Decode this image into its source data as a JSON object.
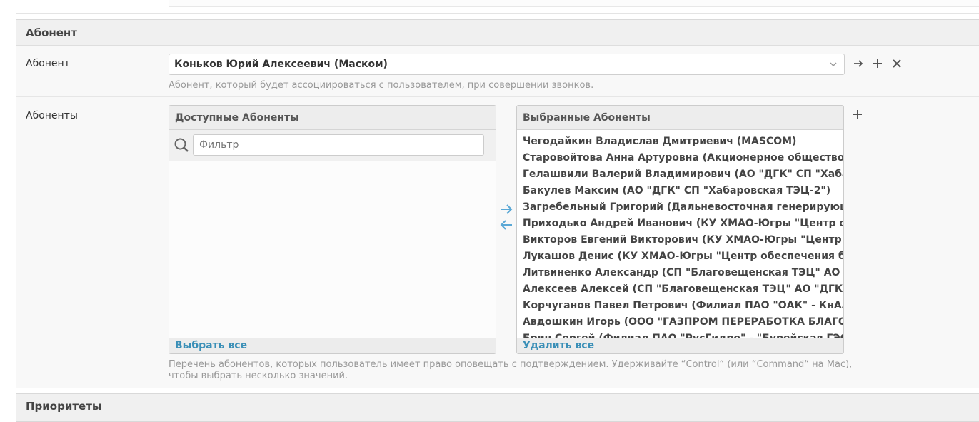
{
  "section": {
    "title": "Абонент",
    "subscriber_field": {
      "label": "Абонент",
      "value": "Коньков Юрий Алексеевич (Маском)",
      "help": "Абонент, который будет ассоциироваться с пользователем, при совершении звонков."
    },
    "subscribers_field": {
      "label": "Абоненты",
      "available": {
        "title": "Доступные Абоненты",
        "filter_placeholder": "Фильтр",
        "choose_all": "Выбрать все"
      },
      "chosen": {
        "title": "Выбранные Абоненты",
        "remove_all": "Удалить все",
        "items": [
          "Чегодайкин Владислав Дмитриевич (MASCOM)",
          "Старовойтова Анна Артуровна (Акционерное общество \"Кор",
          "Гелашвили Валерий Владимирович (АО \"ДГК\" СП \"Хабаров",
          "Бакулев Максим (АО \"ДГК\" СП \"Хабаровская ТЭЦ-2\")",
          "Загребельный Григорий (Дальневосточная генерирующая ко",
          "Приходько Андрей Иванович (КУ ХМАО-Югры \"Центр обеспе",
          "Викторов Евгений Викторович (КУ ХМАО-Югры \"Центр обесп",
          "Лукашов Денис (КУ ХМАО-Югры \"Центр обеспечения безопа",
          "Литвиненко Александр (СП \"Благовещенская ТЭЦ\" АО \"ДГК",
          "Алексеев Алексей (СП \"Благовещенская ТЭЦ\" АО \"ДГК\")",
          "Корчуганов Павел Петрович (Филиал ПАО \"ОАК\" - КнААЗ им",
          "Авдошкин Игорь (ООО \"ГАЗПРОМ ПЕРЕРАБОТКА БЛАГОВЕ",
          "Брин Сергей (Филиал ПАО \"РусГидро\" - \"Бурейская ГЭС\")"
        ]
      },
      "help": "Перечень абонентов, которых пользователь имеет право оповещать с подтверждением. Удерживайте “Control“ (или “Command“ на Mac), чтобы выбрать несколько значений."
    }
  },
  "next_section": {
    "title": "Приоритеты"
  },
  "icons": {
    "dropdown": "chevron-down-icon",
    "edit": "arrow-right-icon",
    "add": "plus-icon",
    "delete": "close-icon",
    "search": "magnifier-icon",
    "move_right": "arrow-right-icon",
    "move_left": "arrow-left-icon"
  },
  "colors": {
    "accent": "#3a8fb7",
    "arrow": "#5aa8d6"
  }
}
